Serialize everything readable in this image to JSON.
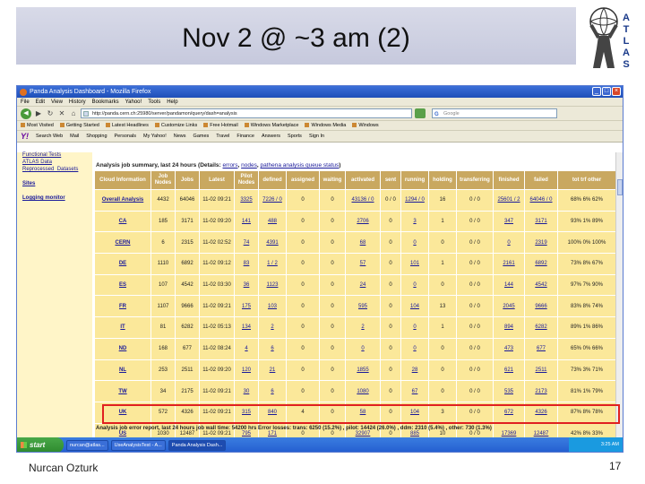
{
  "slide": {
    "title": "Nov 2 @ ~3 am (2)",
    "author": "Nurcan Ozturk",
    "page_number": "17",
    "logo_letters": [
      "A",
      "T",
      "L",
      "A",
      "S"
    ]
  },
  "browser": {
    "window_title": "Panda Analysis Dashboard - Mozilla Firefox",
    "menu": [
      "File",
      "Edit",
      "View",
      "History",
      "Bookmarks",
      "Yahoo!",
      "Tools",
      "Help"
    ],
    "url": "http://panda.cern.ch:25980/server/pandamon/query/dash=analysis",
    "search_placeholder": "Google",
    "bookmarks": [
      "Most Visited",
      "Getting Started",
      "Latest Headlines",
      "Customize Links",
      "Free Hotmail",
      "Windows Marketplace",
      "Windows Media",
      "Windows"
    ],
    "yahoo_bar": [
      "Search Web",
      "Mail",
      "Shopping",
      "Personals",
      "My Yahoo!",
      "News",
      "Games",
      "Travel",
      "Finance",
      "Answers",
      "Sports",
      "Sign In"
    ]
  },
  "sidebar": {
    "links": [
      "Functional Tests",
      "ATLAS Data",
      "Reprocessed_Datasets",
      "Sites",
      "Logging monitor"
    ]
  },
  "page": {
    "summary_heading": "Analysis job summary, last 24 hours (Details:",
    "summary_links": [
      "errors",
      "nodes",
      "pathena analysis queue status"
    ],
    "status_line": "Analysis job error report, last 24 hours job wall time: 54200 hrs   Error losses: trans: 6250 (15.2%) , pilot: 14424 (26.0%) , ddm: 2310 (5.4%) , other: 730 (1.3%)"
  },
  "table": {
    "headers": [
      "Cloud Information",
      "Job Nodes",
      "Jobs",
      "Latest",
      "Pilot Nodes",
      "defined",
      "assigned",
      "waiting",
      "activated",
      "sent",
      "running",
      "holding",
      "transferring",
      "finished",
      "failed",
      "tot trf other"
    ],
    "rows": [
      [
        "Overall Analysis",
        "4432",
        "64046",
        "11-02 09:21",
        "3325",
        "7226 / 0",
        "0",
        "0",
        "43136 / 0",
        "0 / 0",
        "1294 / 0",
        "16",
        "0 / 0",
        "25601 / 2",
        "64046 / 0",
        "68% 6% 62%"
      ],
      [
        "CA",
        "185",
        "3171",
        "11-02 09:20",
        "141",
        "488",
        "0",
        "0",
        "2706",
        "0",
        "3",
        "1",
        "0 / 0",
        "347",
        "3171",
        "93% 1% 89%"
      ],
      [
        "CERN",
        "6",
        "2315",
        "11-02 02:52",
        "74",
        "4391",
        "0",
        "0",
        "68",
        "0",
        "0",
        "0",
        "0 / 0",
        "0",
        "2319",
        "100% 0% 100%"
      ],
      [
        "DE",
        "1110",
        "6892",
        "11-02 09:12",
        "83",
        "1 / 2",
        "0",
        "0",
        "57",
        "0",
        "101",
        "1",
        "0 / 0",
        "2161",
        "6892",
        "73% 8% 67%"
      ],
      [
        "ES",
        "107",
        "4542",
        "11-02 03:30",
        "36",
        "1123",
        "0",
        "0",
        "24",
        "0",
        "0",
        "0",
        "0 / 0",
        "144",
        "4542",
        "97% 7% 90%"
      ],
      [
        "FR",
        "1107",
        "9666",
        "11-02 09:21",
        "175",
        "103",
        "0",
        "0",
        "595",
        "0",
        "104",
        "13",
        "0 / 0",
        "2045",
        "9666",
        "83% 8% 74%"
      ],
      [
        "IT",
        "81",
        "6282",
        "11-02 05:13",
        "134",
        "2",
        "0",
        "0",
        "2",
        "0",
        "0",
        "1",
        "0 / 0",
        "894",
        "6282",
        "89% 1% 86%"
      ],
      [
        "ND",
        "168",
        "677",
        "11-02 08:24",
        "4",
        "6",
        "0",
        "0",
        "0",
        "0",
        "0",
        "0",
        "0 / 0",
        "473",
        "677",
        "65% 0% 66%"
      ],
      [
        "NL",
        "253",
        "2511",
        "11-02 09:20",
        "120",
        "21",
        "0",
        "0",
        "1855",
        "0",
        "28",
        "0",
        "0 / 0",
        "621",
        "2511",
        "73% 3% 71%"
      ],
      [
        "TW",
        "34",
        "2175",
        "11-02 09:21",
        "30",
        "6",
        "0",
        "0",
        "1080",
        "0",
        "67",
        "0",
        "0 / 0",
        "535",
        "2173",
        "81% 1% 79%"
      ],
      [
        "UK",
        "572",
        "4326",
        "11-02 09:21",
        "315",
        "840",
        "4",
        "0",
        "58",
        "0",
        "104",
        "3",
        "0 / 0",
        "672",
        "4326",
        "87% 8% 78%"
      ],
      [
        "US",
        "1030",
        "12487",
        "11-02 09:21",
        "795",
        "171",
        "0",
        "0",
        "32907",
        "0",
        "885",
        "10",
        "0 / 0",
        "17369",
        "12487",
        "42% 8% 33%"
      ]
    ]
  },
  "taskbar": {
    "start_label": "start",
    "items": [
      "nurcan@atlas...",
      "UseAnalysisTest - A...",
      "Panda Analysis Dash..."
    ],
    "clock": "3:25 AM"
  },
  "colors": {
    "title_band": "#c6c9dd",
    "table_header": "#c9a860",
    "table_cell": "#fbe89a",
    "sidebar": "#fff5c8",
    "highlight": "#e02020"
  }
}
